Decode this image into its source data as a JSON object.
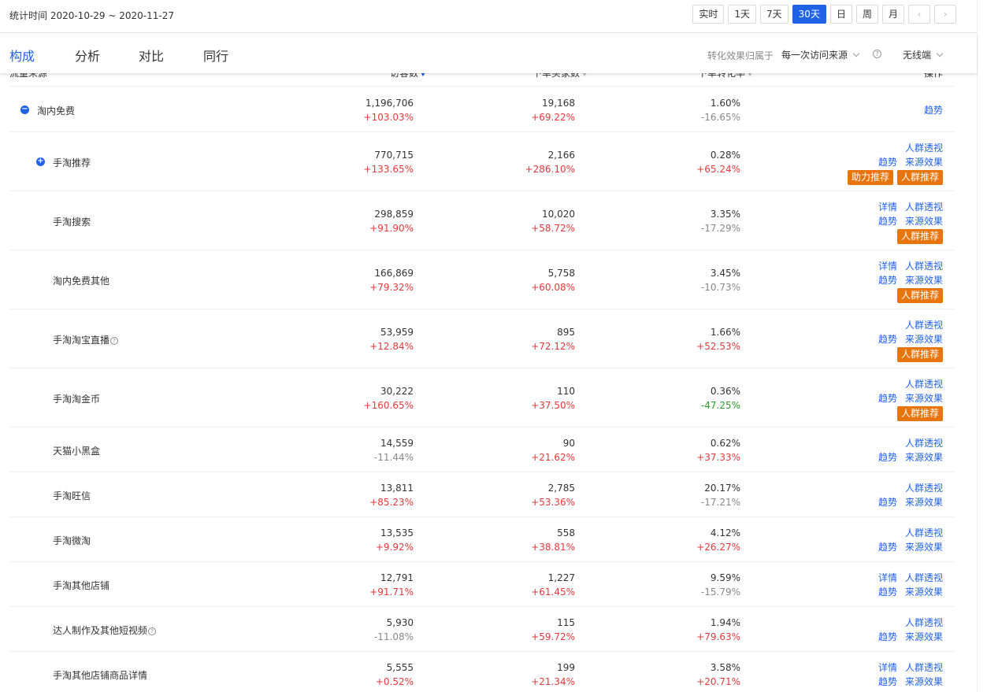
{
  "topbar": {
    "stat_time": "统计时间 2020-10-29 ~ 2020-11-27",
    "periods": [
      "实时",
      "1天",
      "7天",
      "30天",
      "日",
      "周",
      "月"
    ],
    "active_period": "30天",
    "prev_arrow": "‹",
    "next_arrow": "›"
  },
  "tabs": [
    "构成",
    "分析",
    "对比",
    "同行"
  ],
  "active_tab": "构成",
  "attribution": {
    "label": "转化效果归属于",
    "value": "每一次访问来源",
    "help": "?",
    "device": "无线端"
  },
  "table": {
    "headers": {
      "source": "流量来源",
      "visitors": "访客数",
      "buyers": "下单买家数",
      "conversion": "下单转化率",
      "actions": "操作"
    },
    "rows": [
      {
        "source": "淘内免费",
        "toggle": "−",
        "visitors": "1,196,706",
        "visitors_chg": "+103.03%",
        "buyers": "19,168",
        "buyers_chg": "+69.22%",
        "conv": "1.60%",
        "conv_chg": "-16.65%",
        "ops": [
          [
            "趋势"
          ]
        ],
        "tags": []
      },
      {
        "source": "手淘推荐",
        "toggle": "+",
        "visitors": "770,715",
        "visitors_chg": "+133.65%",
        "buyers": "2,166",
        "buyers_chg": "+286.10%",
        "conv": "0.28%",
        "conv_chg": "+65.24%",
        "ops": [
          [
            "人群透视"
          ],
          [
            "趋势",
            "来源效果"
          ]
        ],
        "tags": [
          "助力推荐",
          "人群推荐"
        ]
      },
      {
        "source": "手淘搜索",
        "visitors": "298,859",
        "visitors_chg": "+91.90%",
        "buyers": "10,020",
        "buyers_chg": "+58.72%",
        "conv": "3.35%",
        "conv_chg": "-17.29%",
        "ops": [
          [
            "详情",
            "人群透视"
          ],
          [
            "趋势",
            "来源效果"
          ]
        ],
        "tags": [
          "人群推荐"
        ]
      },
      {
        "source": "淘内免费其他",
        "visitors": "166,869",
        "visitors_chg": "+79.32%",
        "buyers": "5,758",
        "buyers_chg": "+60.08%",
        "conv": "3.45%",
        "conv_chg": "-10.73%",
        "ops": [
          [
            "详情",
            "人群透视"
          ],
          [
            "趋势",
            "来源效果"
          ]
        ],
        "tags": [
          "人群推荐"
        ]
      },
      {
        "source": "手淘淘宝直播",
        "help": "?",
        "visitors": "53,959",
        "visitors_chg": "+12.84%",
        "buyers": "895",
        "buyers_chg": "+72.12%",
        "conv": "1.66%",
        "conv_chg": "+52.53%",
        "ops": [
          [
            "人群透视"
          ],
          [
            "趋势",
            "来源效果"
          ]
        ],
        "tags": [
          "人群推荐"
        ]
      },
      {
        "source": "手淘淘金币",
        "visitors": "30,222",
        "visitors_chg": "+160.65%",
        "buyers": "110",
        "buyers_chg": "+37.50%",
        "conv": "0.36%",
        "conv_chg": "-47.25%",
        "conv_green": true,
        "ops": [
          [
            "人群透视"
          ],
          [
            "趋势",
            "来源效果"
          ]
        ],
        "tags": [
          "人群推荐"
        ]
      },
      {
        "source": "天猫小黑盒",
        "visitors": "14,559",
        "visitors_chg": "-11.44%",
        "buyers": "90",
        "buyers_chg": "+21.62%",
        "conv": "0.62%",
        "conv_chg": "+37.33%",
        "ops": [
          [
            "人群透视"
          ],
          [
            "趋势",
            "来源效果"
          ]
        ],
        "tags": []
      },
      {
        "source": "手淘旺信",
        "visitors": "13,811",
        "visitors_chg": "+85.23%",
        "buyers": "2,785",
        "buyers_chg": "+53.36%",
        "conv": "20.17%",
        "conv_chg": "-17.21%",
        "ops": [
          [
            "人群透视"
          ],
          [
            "趋势",
            "来源效果"
          ]
        ],
        "tags": []
      },
      {
        "source": "手淘微淘",
        "visitors": "13,535",
        "visitors_chg": "+9.92%",
        "buyers": "558",
        "buyers_chg": "+38.81%",
        "conv": "4.12%",
        "conv_chg": "+26.27%",
        "ops": [
          [
            "人群透视"
          ],
          [
            "趋势",
            "来源效果"
          ]
        ],
        "tags": []
      },
      {
        "source": "手淘其他店铺",
        "visitors": "12,791",
        "visitors_chg": "+91.71%",
        "buyers": "1,227",
        "buyers_chg": "+61.45%",
        "conv": "9.59%",
        "conv_chg": "-15.79%",
        "ops": [
          [
            "详情",
            "人群透视"
          ],
          [
            "趋势",
            "来源效果"
          ]
        ],
        "tags": []
      },
      {
        "source": "达人制作及其他短视频",
        "help": "?",
        "visitors": "5,930",
        "visitors_chg": "-11.08%",
        "buyers": "115",
        "buyers_chg": "+59.72%",
        "conv": "1.94%",
        "conv_chg": "+79.63%",
        "ops": [
          [
            "人群透视"
          ],
          [
            "趋势",
            "来源效果"
          ]
        ],
        "tags": []
      },
      {
        "source": "手淘其他店铺商品详情",
        "visitors": "5,555",
        "visitors_chg": "+0.52%",
        "buyers": "199",
        "buyers_chg": "+21.34%",
        "conv": "3.58%",
        "conv_chg": "+20.71%",
        "ops": [
          [
            "详情",
            "人群透视"
          ],
          [
            "趋势",
            "来源效果"
          ]
        ],
        "tags": []
      }
    ]
  }
}
